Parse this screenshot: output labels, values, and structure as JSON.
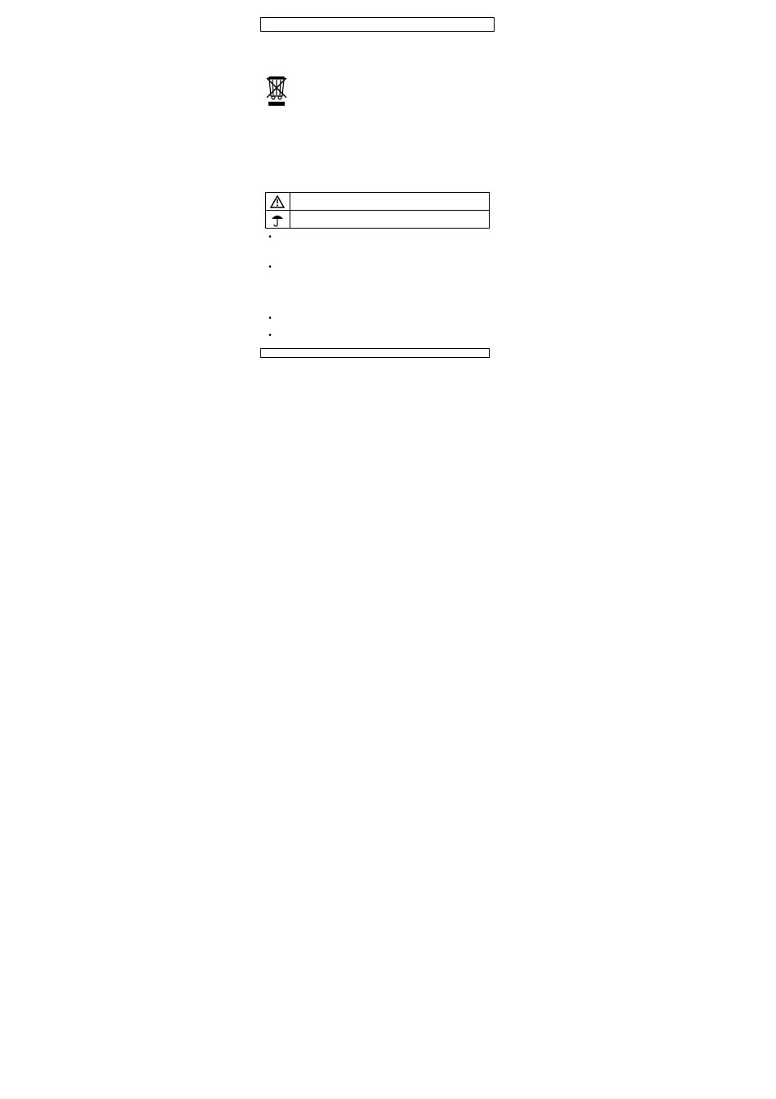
{
  "symbols": {
    "warning_label": "",
    "keep_dry_label": ""
  },
  "bullets": {
    "item1": "",
    "item2": "",
    "item3": "",
    "item4": ""
  }
}
